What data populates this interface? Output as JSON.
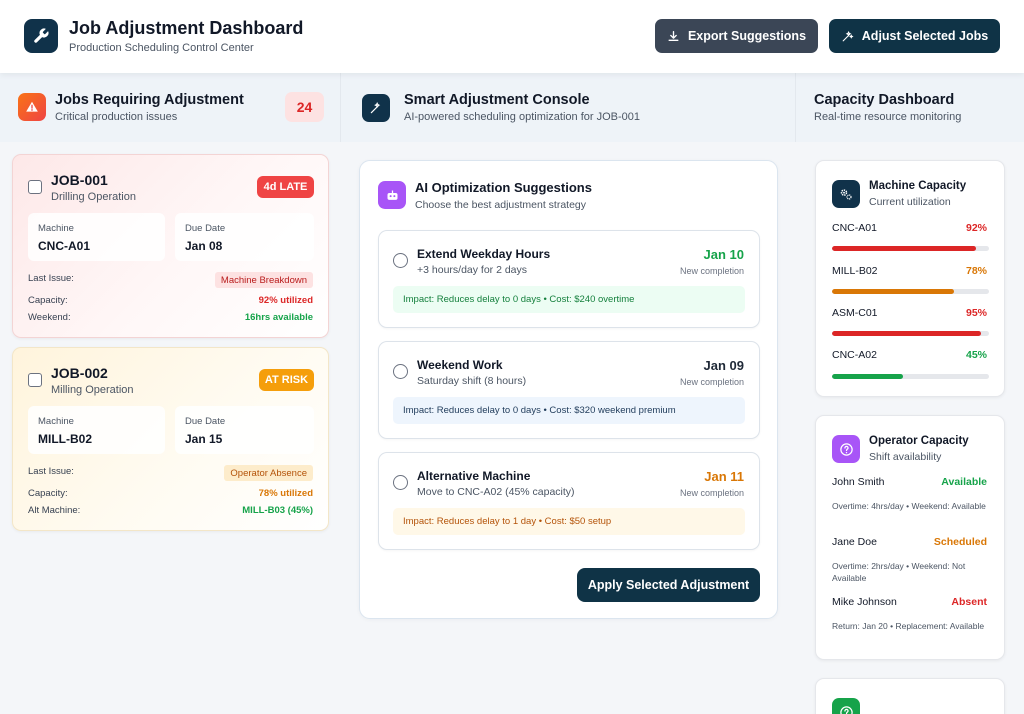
{
  "header": {
    "title": "Job Adjustment Dashboard",
    "subtitle": "Production Scheduling Control Center",
    "logo_icon": "wrench-icon",
    "export_label": "Export Suggestions",
    "adjust_label": "Adjust Selected Jobs"
  },
  "jobs_panel": {
    "title": "Jobs Requiring Adjustment",
    "subtitle": "Critical production issues",
    "count": "24",
    "icon": "warning-icon",
    "jobs": [
      {
        "id": "JOB-001",
        "operation": "Drilling Operation",
        "status": "4d LATE",
        "machine_label": "Machine",
        "machine": "CNC-A01",
        "due_label": "Due Date",
        "due": "Jan 08",
        "issue_label": "Last Issue:",
        "issue": "Machine Breakdown",
        "capacity_label": "Capacity:",
        "capacity": "92% utilized",
        "extra_label": "Weekend:",
        "extra": "16hrs available"
      },
      {
        "id": "JOB-002",
        "operation": "Milling Operation",
        "status": "AT RISK",
        "machine_label": "Machine",
        "machine": "MILL-B02",
        "due_label": "Due Date",
        "due": "Jan 15",
        "issue_label": "Last Issue:",
        "issue": "Operator Absence",
        "capacity_label": "Capacity:",
        "capacity": "78% utilized",
        "extra_label": "Alt Machine:",
        "extra": "MILL-B03 (45%)"
      }
    ]
  },
  "console": {
    "title": "Smart Adjustment Console",
    "subtitle": "AI-powered scheduling optimization for JOB-001",
    "icon": "magic-wand-icon",
    "ai_title": "AI Optimization Suggestions",
    "ai_subtitle": "Choose the best adjustment strategy",
    "ai_icon": "robot-icon",
    "options": [
      {
        "title": "Extend Weekday Hours",
        "desc": "+3 hours/day for 2 days",
        "date": "Jan 10",
        "date_color": "#16a34a",
        "date_label": "New completion",
        "impact": "Impact: Reduces delay to 0 days • Cost: $240 overtime",
        "impact_bg": "#ecfdf3",
        "impact_color": "#15803d"
      },
      {
        "title": "Weekend Work",
        "desc": "Saturday shift (8 hours)",
        "date": "Jan 09",
        "date_color": "#1f2937",
        "date_label": "New completion",
        "impact": "Impact: Reduces delay to 0 days • Cost: $320 weekend premium",
        "impact_bg": "#eef5fd",
        "impact_color": "#1f3b5a"
      },
      {
        "title": "Alternative Machine",
        "desc": "Move to CNC-A02 (45% capacity)",
        "date": "Jan 11",
        "date_color": "#d97706",
        "date_label": "New completion",
        "impact": "Impact: Reduces delay to 1 day • Cost: $50 setup",
        "impact_bg": "#fff8e8",
        "impact_color": "#b45309"
      }
    ],
    "apply_label": "Apply Selected Adjustment"
  },
  "capacity": {
    "title": "Capacity Dashboard",
    "subtitle": "Real-time resource monitoring",
    "machine_title": "Machine Capacity",
    "machine_subtitle": "Current utilization",
    "machine_icon": "gears-icon",
    "machines": [
      {
        "name": "CNC-A01",
        "pct_label": "92%",
        "pct": 92,
        "color": "#dc2626"
      },
      {
        "name": "MILL-B02",
        "pct_label": "78%",
        "pct": 78,
        "color": "#d97706"
      },
      {
        "name": "ASM-C01",
        "pct_label": "95%",
        "pct": 95,
        "color": "#dc2626"
      },
      {
        "name": "CNC-A02",
        "pct_label": "45%",
        "pct": 45,
        "color": "#16a34a"
      }
    ],
    "operator_title": "Operator Capacity",
    "operator_subtitle": "Shift availability",
    "operator_icon": "question-icon",
    "operators": [
      {
        "name": "John Smith",
        "status": "Available",
        "color": "#16a34a",
        "note": "Overtime: 4hrs/day • Weekend: Available"
      },
      {
        "name": "Jane Doe",
        "status": "Scheduled",
        "color": "#d97706",
        "note": "Overtime: 2hrs/day • Weekend: Not Available"
      },
      {
        "name": "Mike Johnson",
        "status": "Absent",
        "color": "#dc2626",
        "note": "Return: Jan 20 • Replacement: Available"
      }
    ]
  }
}
